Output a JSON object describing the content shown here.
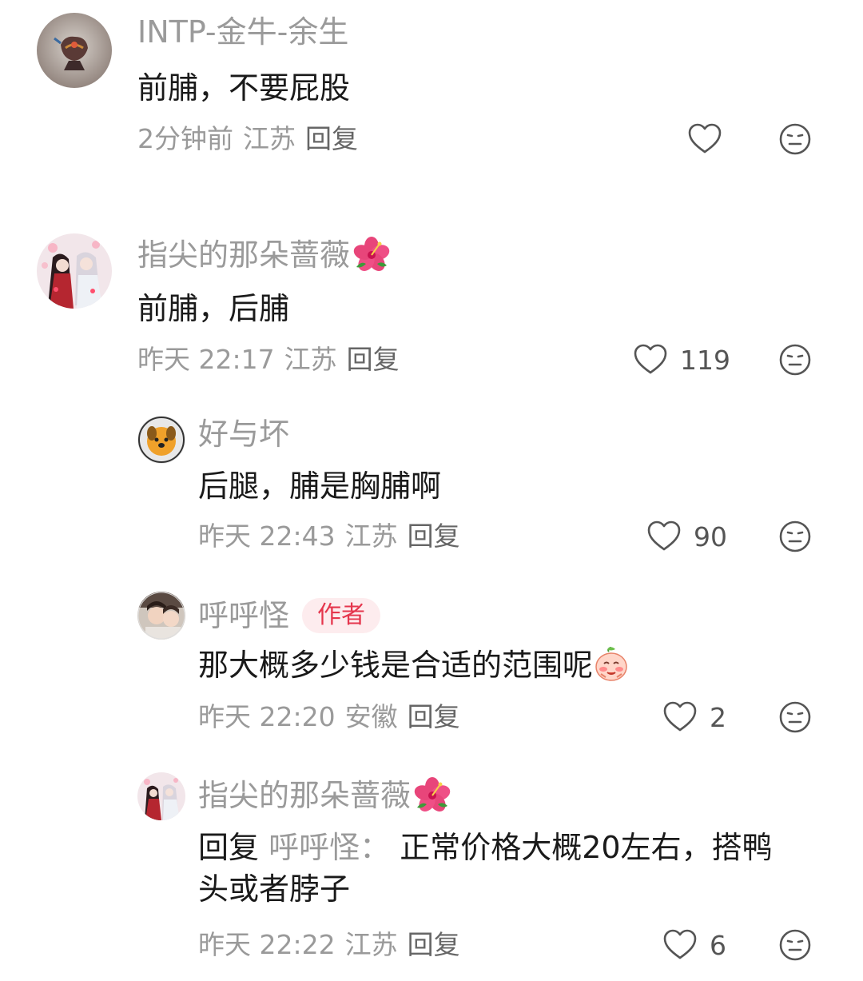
{
  "comments": [
    {
      "username": "INTP-金牛-余生",
      "text": "前脯，不要屁股",
      "time": "2分钟前",
      "location": "江苏",
      "reply_label": "回复",
      "likes": ""
    },
    {
      "username": "指尖的那朵蔷薇",
      "text": "前脯，后脯",
      "time": "昨天 22:17",
      "location": "江苏",
      "reply_label": "回复",
      "likes": "119"
    },
    {
      "username": "好与坏",
      "text": "后腿，脯是胸脯啊",
      "time": "昨天 22:43",
      "location": "江苏",
      "reply_label": "回复",
      "likes": "90"
    },
    {
      "username": "呼呼怪",
      "badge": "作者",
      "text": "那大概多少钱是合适的范围呢",
      "time": "昨天 22:20",
      "location": "安徽",
      "reply_label": "回复",
      "likes": "2"
    },
    {
      "username": "指尖的那朵蔷薇",
      "reply_prefix": "回复",
      "reply_target": "呼呼怪：",
      "text_line1": "正常价格大概20左右，搭鸭",
      "text_line2": "头或者脖子",
      "time": "昨天 22:22",
      "location": "江苏",
      "reply_label": "回复",
      "likes": "6"
    }
  ],
  "icons": {
    "like": "heart-outline-icon",
    "dislike": "neutral-face-icon",
    "flower": "hibiscus-emoji",
    "blush": "blushing-face-emoji"
  },
  "colors": {
    "text": "#1a1a1a",
    "muted": "#9a9a9a",
    "badge_text": "#e5364d",
    "badge_bg": "#fdecee"
  }
}
